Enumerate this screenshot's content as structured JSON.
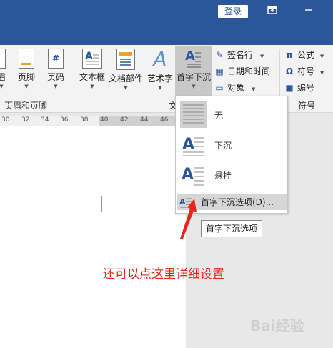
{
  "titlebar": {
    "login_label": "登录",
    "ribbon_display_icon": "ribbon-display-options-icon",
    "minimize_icon": "minimize-icon"
  },
  "ribbon": {
    "header_group": {
      "items": [
        {
          "label": "眉",
          "icon": "page-icon"
        },
        {
          "label": "页脚",
          "icon": "footer-icon"
        },
        {
          "label": "页码",
          "icon": "page-number-icon",
          "glyph": "#"
        }
      ],
      "group_label": "页眉和页脚"
    },
    "text_group": {
      "items": [
        {
          "label": "文本框",
          "icon": "text-box-icon",
          "glyph": "A"
        },
        {
          "label": "文档部件",
          "icon": "quick-parts-icon"
        },
        {
          "label": "艺术字",
          "icon": "wordart-icon",
          "glyph": "A"
        },
        {
          "label": "首字下沉",
          "icon": "drop-cap-icon",
          "glyph": "A"
        }
      ],
      "small_items": [
        {
          "label": "签名行",
          "icon": "signature-line-icon"
        },
        {
          "label": "日期和时间",
          "icon": "date-time-icon"
        },
        {
          "label": "对象",
          "icon": "object-icon"
        }
      ],
      "group_label": "文"
    },
    "symbols_group": {
      "items": [
        {
          "label": "公式",
          "icon": "equation-icon",
          "glyph": "π"
        },
        {
          "label": "符号",
          "icon": "symbol-icon",
          "glyph": "Ω"
        },
        {
          "label": "编号",
          "icon": "number-icon"
        }
      ],
      "group_label": "符号"
    }
  },
  "ruler": {
    "ticks": [
      "30",
      "32",
      "34",
      "36",
      "38",
      "40",
      "42",
      "44",
      "46"
    ]
  },
  "dropdown": {
    "items": [
      {
        "label": "无"
      },
      {
        "label": "下沉"
      },
      {
        "label": "悬挂"
      }
    ],
    "options_label": "首字下沉选项(D)..."
  },
  "tooltip": "首字下沉选项",
  "annotation": "还可以点这里详细设置",
  "watermark": "Bai经验",
  "colors": {
    "titlebar": "#2b579a",
    "ribbon": "#f3f3f3",
    "annotation": "#e8251c",
    "arrow": "#e8251c"
  }
}
